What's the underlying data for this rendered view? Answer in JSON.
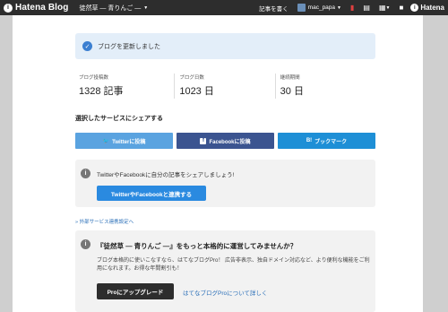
{
  "topbar": {
    "logo_text": "Hatena Blog",
    "blog_name": "徒然草 ― 青りんご ―",
    "write_label": "記事を書く",
    "username": "mac_papa",
    "hatena_label": "Hatena"
  },
  "notice": {
    "message": "ブログを更新しました"
  },
  "stats": [
    {
      "label": "ブログ投稿数",
      "value": "1328 記事"
    },
    {
      "label": "ブログ日数",
      "value": "1023 日"
    },
    {
      "label": "継続期間",
      "value": "30 日"
    }
  ],
  "share": {
    "title": "選択したサービスにシェアする",
    "twitter_label": "Twitterに投稿",
    "facebook_label": "Facebookに投稿",
    "hatebu_label": "ブックマーク",
    "hatebu_prefix": "B!"
  },
  "connect_box": {
    "text": "TwitterやFacebookに自分の記事をシェアしましょう!",
    "button_label": "TwitterやFacebookと連携する"
  },
  "external_link": "» 外部サービス連携設定へ",
  "pro_box": {
    "title": "『徒然草 ― 青りんご ―』をもっと本格的に運営してみませんか？",
    "description": "ブログ本格的に使いこなすなら、はてなブログPro！ 広告非表示、独自ドメイン対応など、より便利な機能をご利用になれます。お得な年間割引も！",
    "upgrade_label": "Proにアップグレード",
    "learn_more_label": "はてなブログProについて詳しく"
  },
  "colors": {
    "topbar": "#2d2d2d",
    "notice_bg": "#e3eef9",
    "twitter": "#5aa3e0",
    "facebook": "#3b5490",
    "hatebu": "#1e8fd6",
    "primary_button": "#2a8ae0"
  }
}
